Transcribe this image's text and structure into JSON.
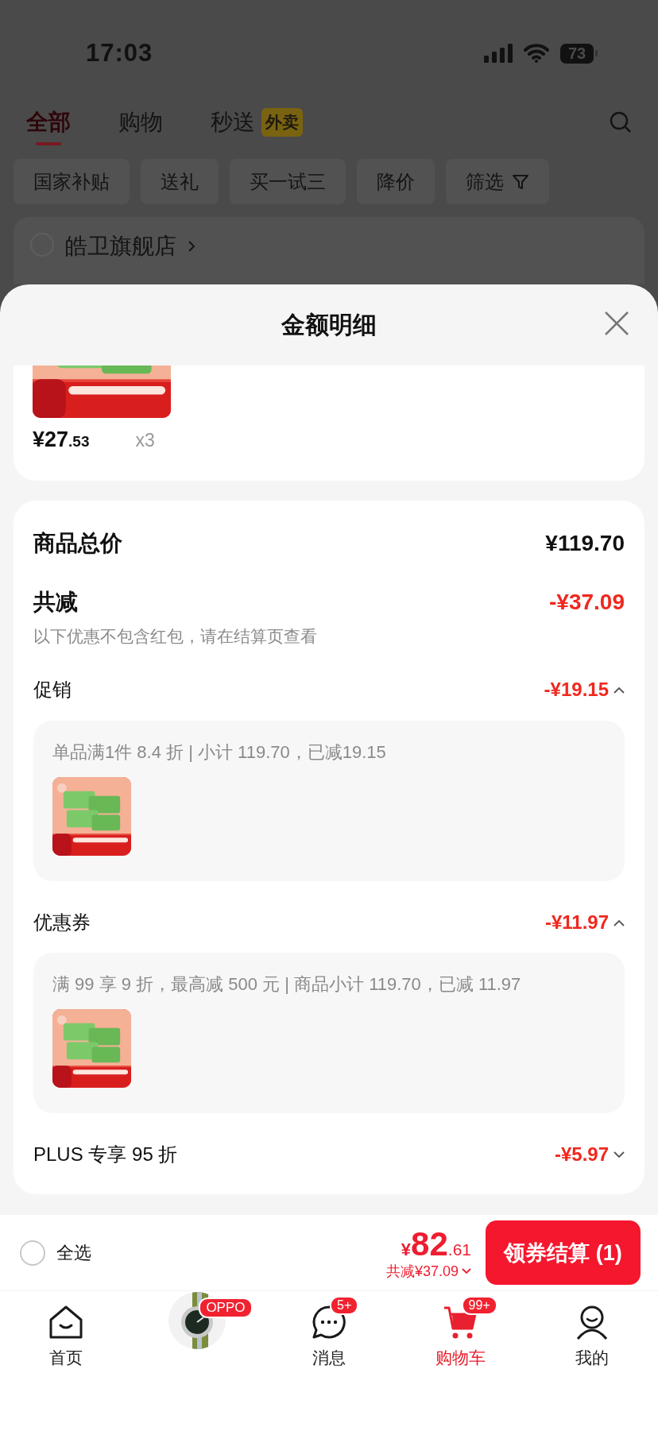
{
  "status_bar": {
    "time": "17:03",
    "battery": "73"
  },
  "top_tabs": [
    {
      "label": "全部",
      "selected": true
    },
    {
      "label": "购物",
      "selected": false
    },
    {
      "label": "秒送",
      "badge": "外卖",
      "selected": false
    }
  ],
  "filters": [
    {
      "label": "国家补贴",
      "kind": "chip"
    },
    {
      "label": "送礼",
      "kind": "chip"
    },
    {
      "label": "买一试三",
      "kind": "chip"
    },
    {
      "label": "降价",
      "kind": "chip"
    },
    {
      "label": "筛选",
      "kind": "filter"
    }
  ],
  "store": {
    "name": "皓卫旗舰店",
    "checked": false
  },
  "sheet": {
    "title": "金额明细",
    "product": {
      "price": "¥27",
      "price_decimal": ".53",
      "quantity": "x3"
    },
    "summary": {
      "total": {
        "label": "商品总价",
        "value": "¥119.70"
      },
      "reduction": {
        "label": "共减",
        "value": "-¥37.09",
        "note": "以下优惠不包含红包，请在结算页查看"
      },
      "discounts": [
        {
          "label": "促销",
          "value": "-¥19.15",
          "expanded": true,
          "detail": "单品满1件 8.4 折 | 小计 119.70，已减19.15"
        },
        {
          "label": "优惠券",
          "value": "-¥11.97",
          "expanded": true,
          "detail": "满 99 享 9 折，最高减 500 元 | 商品小计 119.70，已减 11.97"
        },
        {
          "label": "PLUS 专享 95 折",
          "value": "-¥5.97",
          "expanded": false
        }
      ]
    }
  },
  "checkout": {
    "select_all": "全选",
    "checked": false,
    "currency": "¥",
    "amount": "82",
    "amount_decimal": ".61",
    "savings": "共减¥37.09",
    "button": "领券结算 (1)"
  },
  "tab_bar": [
    {
      "kind": "home",
      "label": "首页",
      "selected": false
    },
    {
      "kind": "promo",
      "badge": "OPPO",
      "selected": false
    },
    {
      "kind": "message",
      "label": "消息",
      "badge": "5+",
      "selected": false
    },
    {
      "kind": "cart",
      "label": "购物车",
      "badge": "99+",
      "selected": true
    },
    {
      "kind": "profile",
      "label": "我的",
      "selected": false
    }
  ]
}
